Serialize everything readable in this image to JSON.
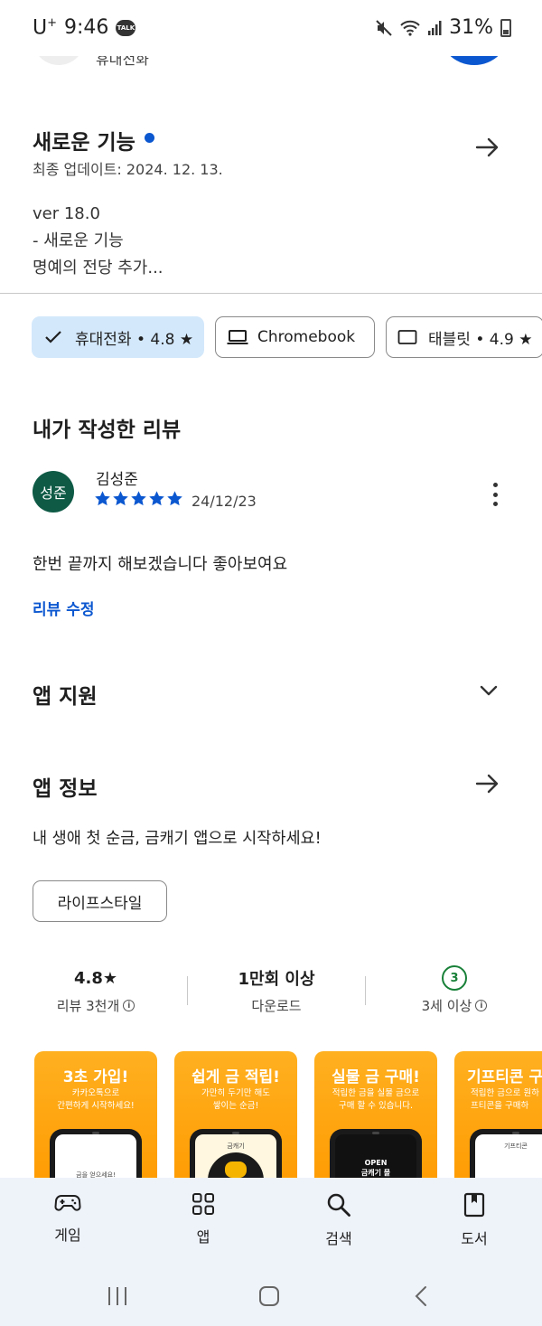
{
  "status_bar": {
    "carrier": "U",
    "carrier_sup": "+",
    "time": "9:46",
    "talk_badge": "TALK",
    "battery": "31%"
  },
  "app_header": {
    "category": "휴대전화"
  },
  "whats_new": {
    "title": "새로운 기능",
    "updated": "최종 업데이트: 2024. 12. 13.",
    "notes": [
      "ver 18.0",
      "- 새로운 기능",
      "명예의 전당 추가..."
    ]
  },
  "device_chips": [
    {
      "label": "휴대전화 • 4.8 ★",
      "selected": true,
      "icon": "check-icon"
    },
    {
      "label": "Chromebook",
      "selected": false,
      "icon": "laptop-icon"
    },
    {
      "label": "태블릿 • 4.9 ★",
      "selected": false,
      "icon": "tablet-icon"
    }
  ],
  "my_review": {
    "section_title": "내가 작성한 리뷰",
    "avatar_text": "성준",
    "reviewer": "김성준",
    "stars": 5,
    "date": "24/12/23",
    "body": "한번 끝까지 해보겠습니다 좋아보여요",
    "edit_label": "리뷰 수정"
  },
  "app_support": {
    "title": "앱 지원"
  },
  "app_info": {
    "title": "앱 정보",
    "description": "내 생애 첫 순금, 금캐기 앱으로 시작하세요!",
    "tag": "라이프스타일"
  },
  "stats": [
    {
      "value": "4.8★",
      "label": "리뷰 3천개"
    },
    {
      "value": "1만회 이상",
      "label": "다운로드"
    },
    {
      "value": "3",
      "label": "3세 이상"
    }
  ],
  "screenshots": [
    {
      "title": "3초 가입!",
      "subtitle": "카카오톡으로\n간편하게 시작하세요!",
      "screen_text": "금을 얻으세요!"
    },
    {
      "title": "쉽게 금 적립!",
      "subtitle": "가만히 두기만 해도\n쌓이는 순금!",
      "screen_text": "금캐기"
    },
    {
      "title": "실물 금 구매!",
      "subtitle": "적립한 금을 실물 금으로\n구매 할 수 있습니다.",
      "screen_text": "OPEN\n금캐기 몰"
    },
    {
      "title": "기프티콘 구",
      "subtitle": "적립한 금으로 원하\n기프티콘을 구매하",
      "screen_text": "기프티콘"
    }
  ],
  "bottom_nav": [
    {
      "label": "게임",
      "icon": "gamepad-icon"
    },
    {
      "label": "앱",
      "icon": "apps-grid-icon"
    },
    {
      "label": "검색",
      "icon": "search-icon"
    },
    {
      "label": "도서",
      "icon": "book-icon"
    }
  ],
  "colors": {
    "accent": "#0b57d0",
    "chip_selected_bg": "#d3e8fb",
    "avatar_bg": "#0e5a45",
    "age_badge": "#188038",
    "screenshot_orange": "#ff9a00",
    "nav_bg": "#eef2f9"
  }
}
